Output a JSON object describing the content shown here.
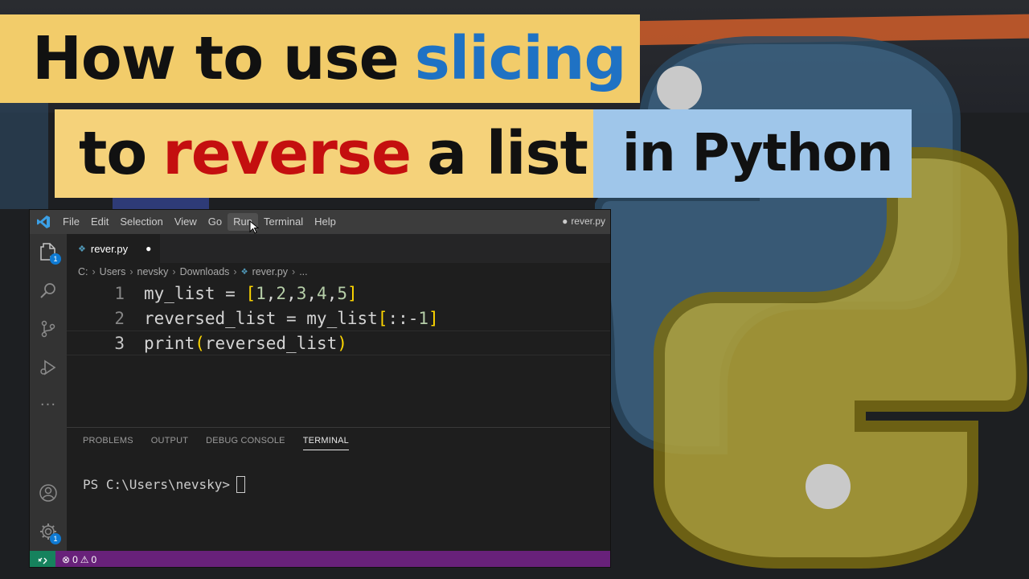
{
  "title": {
    "line1_prefix": "How to use",
    "line1_highlight": "slicing",
    "line2_prefix": "to",
    "line2_highlight": "reverse",
    "line2_suffix": "a list",
    "line3": "in Python"
  },
  "colors": {
    "highlight_blue": "#1f72c4",
    "highlight_red": "#c40f0f",
    "banner_yellow": "#f2cc6a",
    "banner_blue": "#9fc6ea",
    "statusbar_purple": "#68217a"
  },
  "menu": [
    "File",
    "Edit",
    "Selection",
    "View",
    "Go",
    "Run",
    "Terminal",
    "Help"
  ],
  "window_title": "rever.py",
  "window_title_dot": "●",
  "tab": {
    "filename": "rever.py",
    "dirty_indicator": "●"
  },
  "breadcrumb": [
    "C:",
    "Users",
    "nevsky",
    "Downloads",
    "rever.py",
    "..."
  ],
  "editor": {
    "line_numbers": [
      "1",
      "2",
      "3"
    ],
    "lines": [
      "my_list = [1,2,3,4,5]",
      "reversed_list = my_list[::-1]",
      "print(reversed_list)"
    ]
  },
  "activity_badges": {
    "explorer": "1",
    "settings": "1"
  },
  "panel": {
    "tabs": [
      "PROBLEMS",
      "OUTPUT",
      "DEBUG CONSOLE",
      "TERMINAL"
    ],
    "active_tab": "TERMINAL",
    "prompt": "PS C:\\Users\\nevsky>"
  },
  "statusbar": {
    "errors": "0",
    "warnings": "0"
  }
}
